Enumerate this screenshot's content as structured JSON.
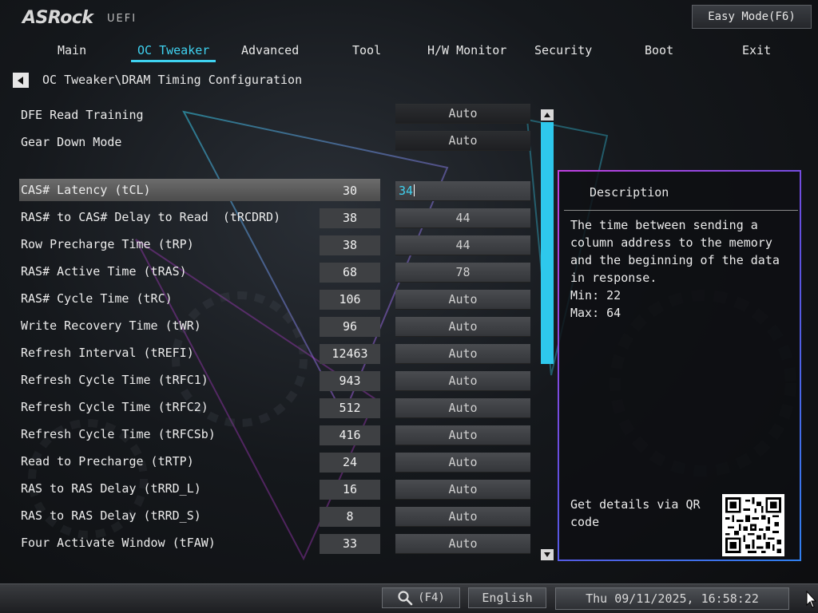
{
  "header": {
    "logo": "ASRock",
    "logo_sub": "UEFI",
    "easy_mode_label": "Easy Mode(F6)"
  },
  "nav": {
    "tabs": [
      {
        "label": "Main"
      },
      {
        "label": "OC Tweaker"
      },
      {
        "label": "Advanced"
      },
      {
        "label": "Tool"
      },
      {
        "label": "H/W Monitor"
      },
      {
        "label": "Security"
      },
      {
        "label": "Boot"
      },
      {
        "label": "Exit"
      }
    ],
    "active": "OC Tweaker"
  },
  "breadcrumb": "OC Tweaker\\DRAM Timing Configuration",
  "settings": {
    "top": [
      {
        "label": "DFE Read Training",
        "value": "Auto"
      },
      {
        "label": "Gear Down Mode",
        "value": "Auto"
      }
    ],
    "timings": [
      {
        "label": "CAS# Latency (tCL)",
        "current": "30",
        "value": "34"
      },
      {
        "label": "RAS# to CAS# Delay to Read  (tRCDRD)",
        "current": "38",
        "value": "44"
      },
      {
        "label": "Row Precharge Time (tRP)",
        "current": "38",
        "value": "44"
      },
      {
        "label": "RAS# Active Time (tRAS)",
        "current": "68",
        "value": "78"
      },
      {
        "label": "RAS# Cycle Time (tRC)",
        "current": "106",
        "value": "Auto"
      },
      {
        "label": "Write Recovery Time (tWR)",
        "current": "96",
        "value": "Auto"
      },
      {
        "label": "Refresh Interval (tREFI)",
        "current": "12463",
        "value": "Auto"
      },
      {
        "label": "Refresh Cycle Time (tRFC1)",
        "current": "943",
        "value": "Auto"
      },
      {
        "label": "Refresh Cycle Time (tRFC2)",
        "current": "512",
        "value": "Auto"
      },
      {
        "label": "Refresh Cycle Time (tRFCSb)",
        "current": "416",
        "value": "Auto"
      },
      {
        "label": "Read to Precharge (tRTP)",
        "current": "24",
        "value": "Auto"
      },
      {
        "label": "RAS to RAS Delay (tRRD_L)",
        "current": "16",
        "value": "Auto"
      },
      {
        "label": "RAS to RAS Delay (tRRD_S)",
        "current": "8",
        "value": "Auto"
      },
      {
        "label": "Four Activate Window (tFAW)",
        "current": "33",
        "value": "Auto"
      }
    ]
  },
  "description": {
    "title": "Description",
    "text": "The time between sending a column address to the memory and the beginning of the data in response.",
    "min": "Min: 22",
    "max": "Max: 64",
    "qr_text": "Get details via QR code"
  },
  "footer": {
    "search_label": "(F4)",
    "language": "English",
    "datetime": "Thu 09/11/2025, 16:58:22"
  },
  "colors": {
    "accent": "#3fd2f0",
    "scroll_thumb": "#2ec8ec",
    "panel_border_start": "#c040e0",
    "panel_border_end": "#3080f0"
  }
}
